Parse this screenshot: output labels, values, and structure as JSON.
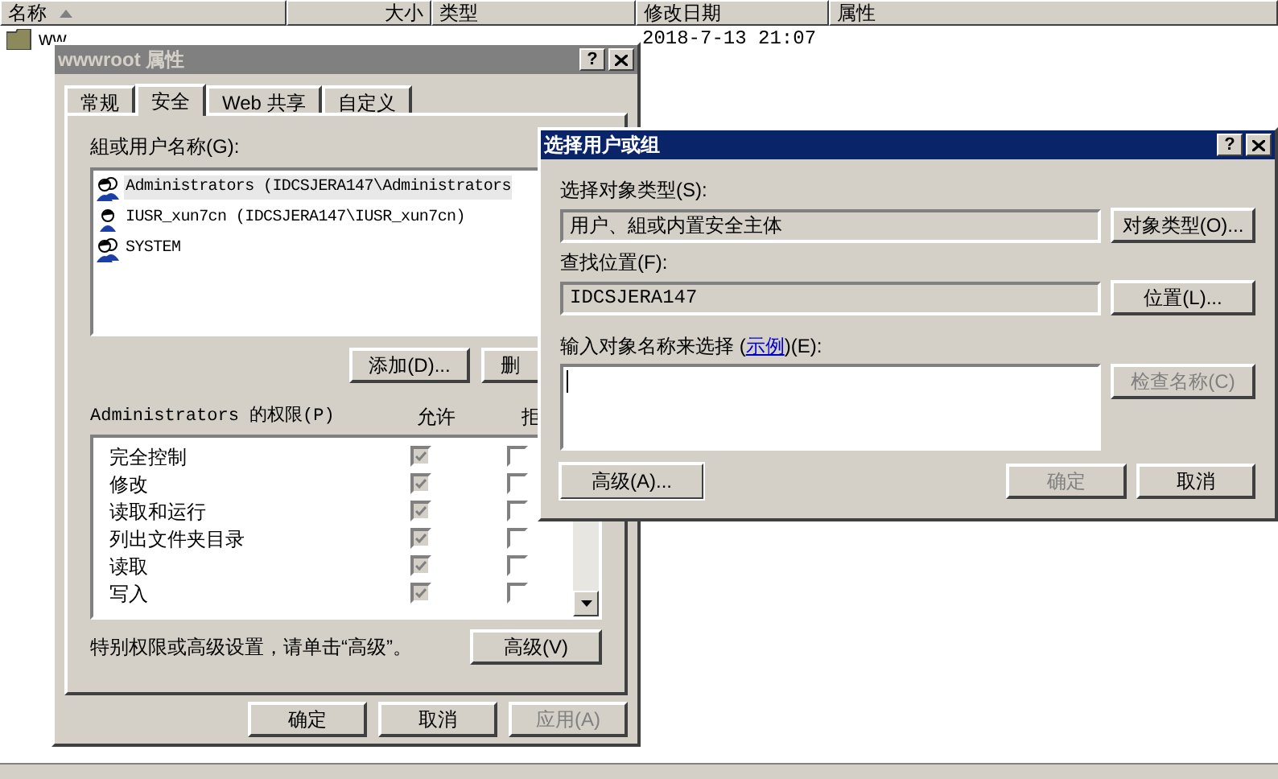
{
  "explorer": {
    "columns": [
      {
        "label": "名称",
        "sorted": true
      },
      {
        "label": "大小",
        "sorted": false
      },
      {
        "label": "类型",
        "sorted": false
      },
      {
        "label": "修改日期",
        "sorted": false
      },
      {
        "label": "属性",
        "sorted": false
      }
    ],
    "rows": [
      {
        "name": "ww",
        "date": "2018-7-13 21:07"
      }
    ]
  },
  "properties_dialog": {
    "title": "wwwroot 属性",
    "active": false,
    "help": "?",
    "tabs": [
      {
        "label": "常规",
        "selected": false
      },
      {
        "label": "安全",
        "selected": true
      },
      {
        "label": "Web 共享",
        "selected": false
      },
      {
        "label": "自定义",
        "selected": false
      }
    ],
    "users_label": "組或用户名称(G):",
    "users": [
      {
        "name": "Administrators (IDCSJERA147\\Administrators",
        "kind": "group",
        "selected": true
      },
      {
        "name": "IUSR_xun7cn (IDCSJERA147\\IUSR_xun7cn)",
        "kind": "user",
        "selected": false
      },
      {
        "name": "SYSTEM",
        "kind": "group",
        "selected": false
      }
    ],
    "add_button": "添加(D)...",
    "remove_button": "删",
    "permissions_label": "Administrators 的权限(P)",
    "allow_header": "允许",
    "deny_header": "拒",
    "permissions": [
      {
        "name": "完全控制",
        "allow": true,
        "allow_disabled": true,
        "deny": false
      },
      {
        "name": "修改",
        "allow": true,
        "allow_disabled": true,
        "deny": false
      },
      {
        "name": "读取和运行",
        "allow": true,
        "allow_disabled": true,
        "deny": false
      },
      {
        "name": "列出文件夹目录",
        "allow": true,
        "allow_disabled": true,
        "deny": false
      },
      {
        "name": "读取",
        "allow": true,
        "allow_disabled": true,
        "deny": false
      },
      {
        "name": "写入",
        "allow": true,
        "allow_disabled": true,
        "deny": false
      }
    ],
    "advanced_hint": "特别权限或高级设置，请单击“高级”。",
    "advanced_button": "高级(V)",
    "buttons": [
      {
        "label": "确定",
        "disabled": false
      },
      {
        "label": "取消",
        "disabled": false
      },
      {
        "label": "应用(A)",
        "disabled": true
      }
    ]
  },
  "select_dialog": {
    "title": "选择用户或组",
    "active": true,
    "help": "?",
    "object_type_label": "选择对象类型(S):",
    "object_type_value": "用户、組或内置安全主体",
    "object_types_button": "对象类型(O)...",
    "location_label": "查找位置(F):",
    "location_value": "IDCSJERA147",
    "location_button": "位置(L)...",
    "names_label_before": "输入对象名称来选择 (",
    "names_link": "示例",
    "names_label_after": ")(E):",
    "check_names_button": {
      "label": "检查名称(C)",
      "disabled": true
    },
    "advanced_button": "高级(A)...",
    "ok_button": {
      "label": "确定",
      "disabled": true
    },
    "cancel_button": {
      "label": "取消",
      "disabled": false
    }
  }
}
